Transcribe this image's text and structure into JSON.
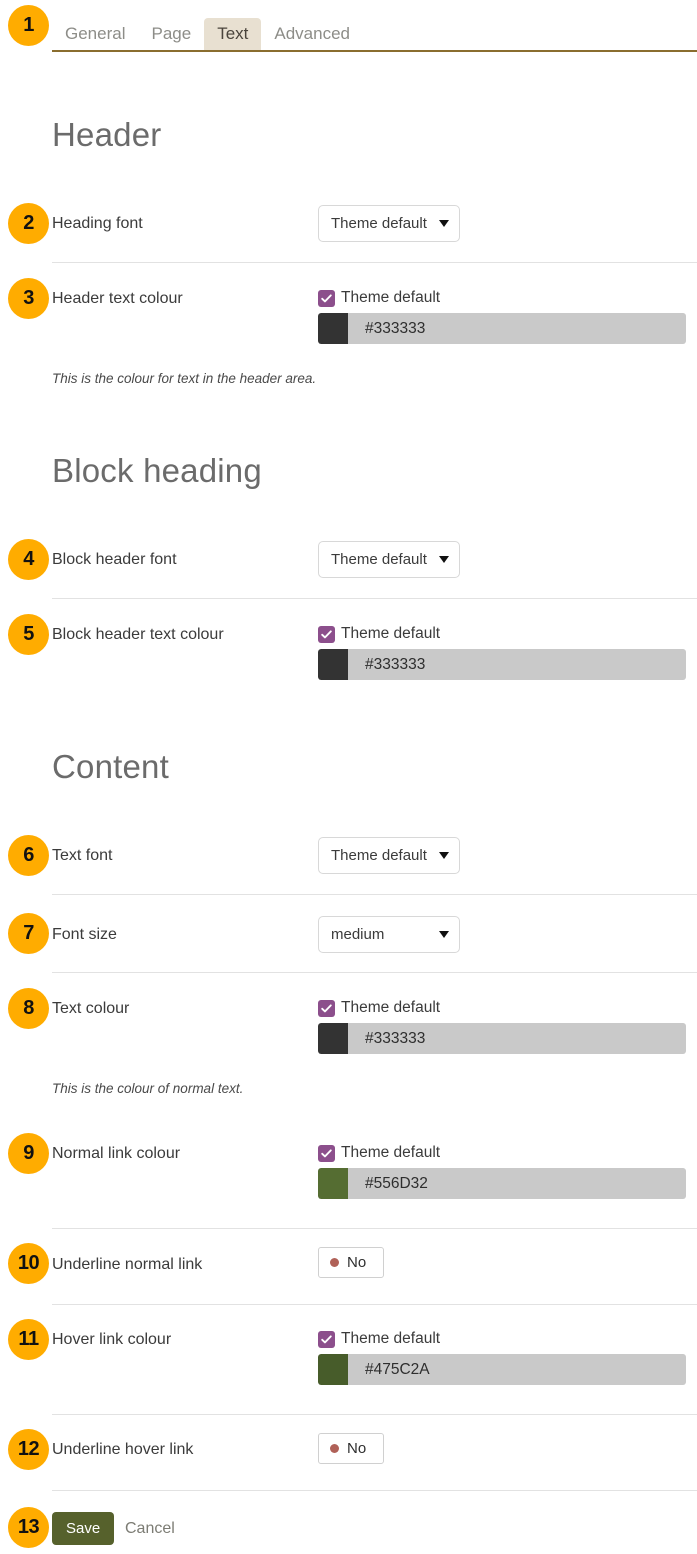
{
  "tabs": [
    {
      "label": "General",
      "active": false
    },
    {
      "label": "Page",
      "active": false
    },
    {
      "label": "Text",
      "active": true
    },
    {
      "label": "Advanced",
      "active": false
    }
  ],
  "badges": {
    "b1": "1",
    "b2": "2",
    "b3": "3",
    "b4": "4",
    "b5": "5",
    "b6": "6",
    "b7": "7",
    "b8": "8",
    "b9": "9",
    "b10": "10",
    "b11": "11",
    "b12": "12",
    "b13": "13"
  },
  "sections": {
    "header": "Header",
    "block_heading": "Block heading",
    "content": "Content"
  },
  "fields": {
    "heading_font": {
      "label": "Heading font",
      "select_value": "Theme default"
    },
    "header_text_colour": {
      "label": "Header text colour",
      "theme_default_label": "Theme default",
      "hex": "#333333",
      "swatch": "#333333",
      "help": "This is the colour for text in the header area."
    },
    "block_header_font": {
      "label": "Block header font",
      "select_value": "Theme default"
    },
    "block_header_text_colour": {
      "label": "Block header text colour",
      "theme_default_label": "Theme default",
      "hex": "#333333",
      "swatch": "#333333"
    },
    "text_font": {
      "label": "Text font",
      "select_value": "Theme default"
    },
    "font_size": {
      "label": "Font size",
      "select_value": "medium"
    },
    "text_colour": {
      "label": "Text colour",
      "theme_default_label": "Theme default",
      "hex": "#333333",
      "swatch": "#333333",
      "help": "This is the colour of normal text."
    },
    "normal_link_colour": {
      "label": "Normal link colour",
      "theme_default_label": "Theme default",
      "hex": "#556D32",
      "swatch": "#556D32"
    },
    "underline_normal_link": {
      "label": "Underline normal link",
      "toggle_value": "No"
    },
    "hover_link_colour": {
      "label": "Hover link colour",
      "theme_default_label": "Theme default",
      "hex": "#475C2A",
      "swatch": "#475C2A"
    },
    "underline_hover_link": {
      "label": "Underline hover link",
      "toggle_value": "No"
    }
  },
  "footer": {
    "save_label": "Save",
    "cancel_label": "Cancel"
  },
  "colors": {
    "badge_orange": "#FFAC00",
    "active_tab_bg": "#E8E0D1",
    "tab_border": "#8A6D2F",
    "checkbox_purple": "#8C4F8C",
    "save_green": "#56612C",
    "toggle_dot": "#B06158",
    "colorfield_bg": "#C9C9C9"
  }
}
